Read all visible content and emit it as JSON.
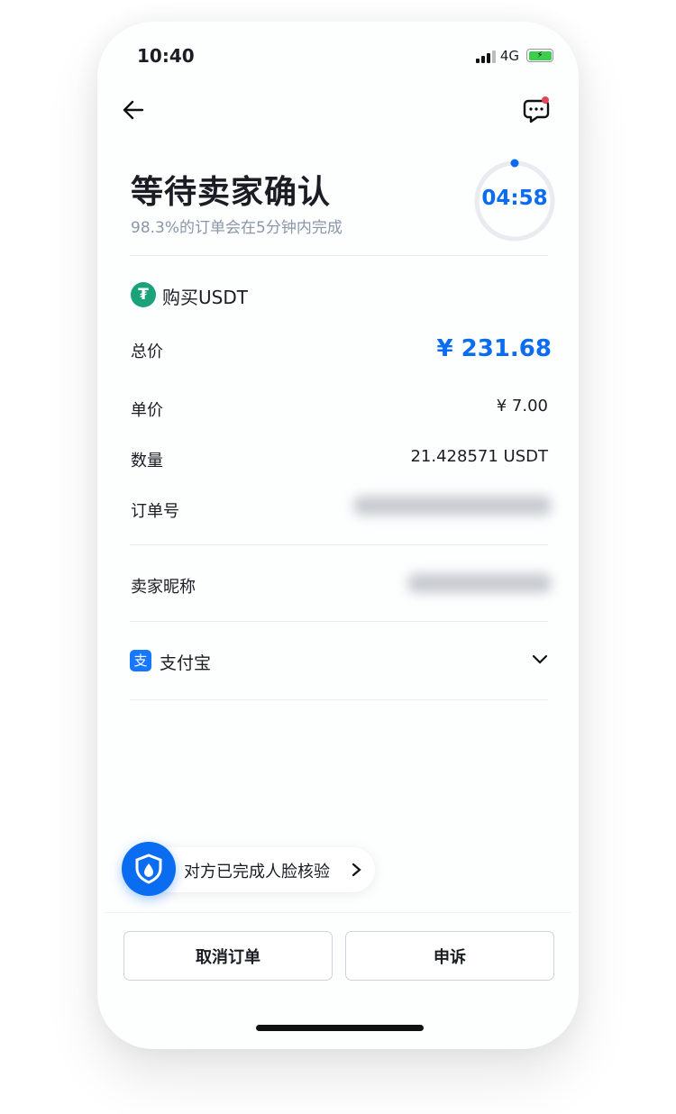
{
  "status_bar": {
    "time": "10:40",
    "network": "4G",
    "battery_icon": "battery-charging-icon"
  },
  "header": {
    "back_icon": "arrow-left-icon",
    "chat_icon": "chat-bubble-icon",
    "has_notification": true
  },
  "status": {
    "title": "等待卖家确认",
    "subtitle": "98.3%的订单会在5分钟内完成",
    "countdown": "04:58",
    "countdown_fraction_remaining": 0.993
  },
  "order": {
    "coin_label": "购买USDT",
    "coin_icon": "tether-icon",
    "rows": [
      {
        "label": "总价",
        "value": "¥ 231.68"
      },
      {
        "label": "单价",
        "value": "¥ 7.00"
      },
      {
        "label": "数量",
        "value": "21.428571 USDT"
      },
      {
        "label": "订单号",
        "value": ""
      }
    ],
    "seller_label": "卖家昵称",
    "payment_method": "支付宝",
    "payment_icon_char": "支"
  },
  "face_verify": {
    "label": "对方已完成人脸核验"
  },
  "actions": {
    "cancel": "取消订单",
    "appeal": "申诉"
  },
  "colors": {
    "accent": "#0a6cf0",
    "tether": "#1ba27a",
    "alipay": "#1677ff",
    "notify": "#e0455a"
  }
}
